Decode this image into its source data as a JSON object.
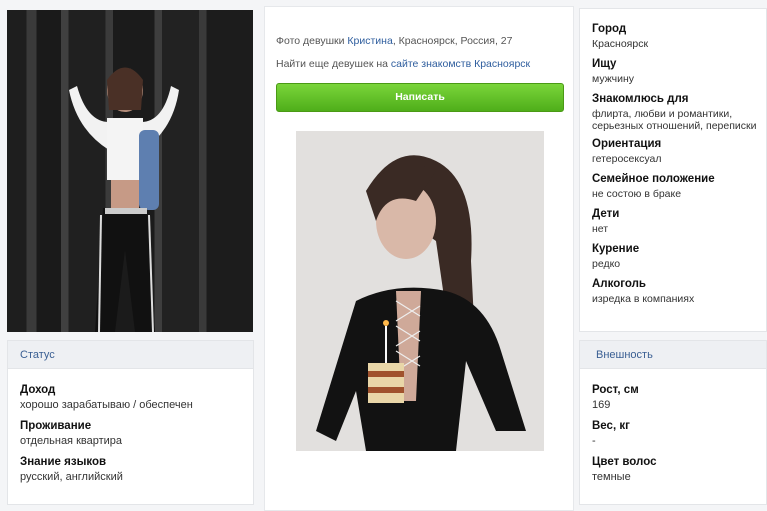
{
  "left": {
    "status_header": "Статус",
    "fields": [
      {
        "label": "Доход",
        "value": "хорошо зарабатываю / обеспечен"
      },
      {
        "label": "Проживание",
        "value": "отдельная квартира"
      },
      {
        "label": "Знание языков",
        "value": "русский, английский"
      }
    ]
  },
  "middle": {
    "photo_caption_prefix": "Фото девушки",
    "name_link": "Кристина",
    "photo_caption_suffix": ", Красноярск, Россия, 27",
    "find_more_prefix": "Найти еще девушек на",
    "site_link": "сайте знакомств Красноярск",
    "write_button": "Написать"
  },
  "right": {
    "fields": [
      {
        "label": "Город",
        "value": "Красноярск"
      },
      {
        "label": "Ищу",
        "value": "мужчину"
      },
      {
        "label": "Знакомлюсь для",
        "value": "флирта, любви и романтики, серьезных отношений, переписки"
      },
      {
        "label": "Ориентация",
        "value": "гетеросексуал"
      },
      {
        "label": "Семейное положение",
        "value": "не состою в браке"
      },
      {
        "label": "Дети",
        "value": "нет"
      },
      {
        "label": "Курение",
        "value": "редко"
      },
      {
        "label": "Алкоголь",
        "value": "изредка в компаниях"
      }
    ],
    "appearance_header": "Внешность",
    "appearance": [
      {
        "label": "Рост, см",
        "value": "169"
      },
      {
        "label": "Вес, кг",
        "value": "-"
      },
      {
        "label": "Цвет волос",
        "value": "темные"
      }
    ]
  }
}
